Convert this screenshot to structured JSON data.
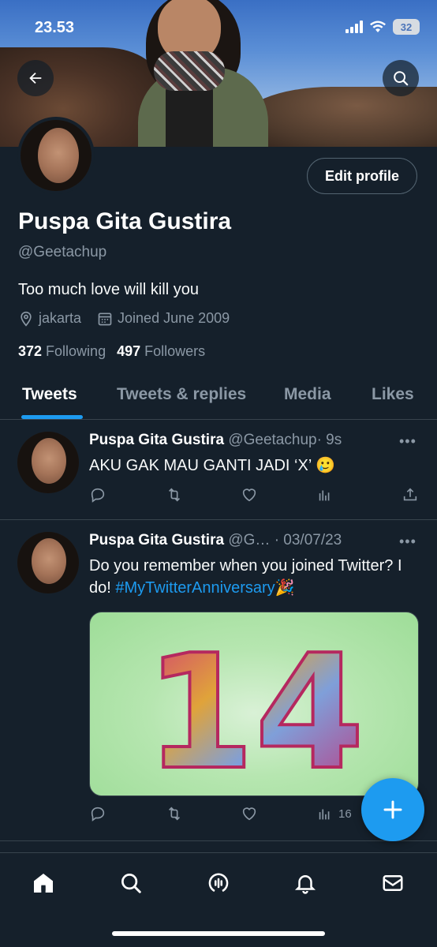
{
  "status_bar": {
    "time": "23.53",
    "battery": "32"
  },
  "header": {
    "back_icon": "back-arrow-icon",
    "search_icon": "search-icon"
  },
  "profile": {
    "edit_label": "Edit profile",
    "name": "Puspa Gita Gustira",
    "handle": "@Geetachup",
    "bio": "Too much love will kill you",
    "location": "jakarta",
    "joined": "Joined June 2009",
    "following_count": "372",
    "following_label": "Following",
    "followers_count": "497",
    "followers_label": "Followers"
  },
  "tabs": [
    {
      "label": "Tweets"
    },
    {
      "label": "Tweets & replies"
    },
    {
      "label": "Media"
    },
    {
      "label": "Likes"
    }
  ],
  "tweets": [
    {
      "name": "Puspa Gita Gustira",
      "handle": "@Geetachup",
      "time": "· 9s",
      "text": "AKU GAK MAU GANTI JADI ‘X’ 🥲",
      "more": "•••"
    },
    {
      "name": "Puspa Gita Gustira",
      "handle": "@G…",
      "time": "· 03/07/23",
      "text_before": "Do you remember when you joined Twitter? I do! ",
      "hashtag": "#MyTwitterAnniversary",
      "emoji": "🎉",
      "media_text": "14",
      "views": "16",
      "more": "•••"
    }
  ],
  "fab": {
    "icon": "plus-icon"
  },
  "bottom_nav": [
    "home-icon",
    "search-icon",
    "spaces-icon",
    "bell-icon",
    "mail-icon"
  ],
  "colors": {
    "accent": "#1d9bf0",
    "background": "#15202b",
    "muted": "#8b98a5"
  }
}
